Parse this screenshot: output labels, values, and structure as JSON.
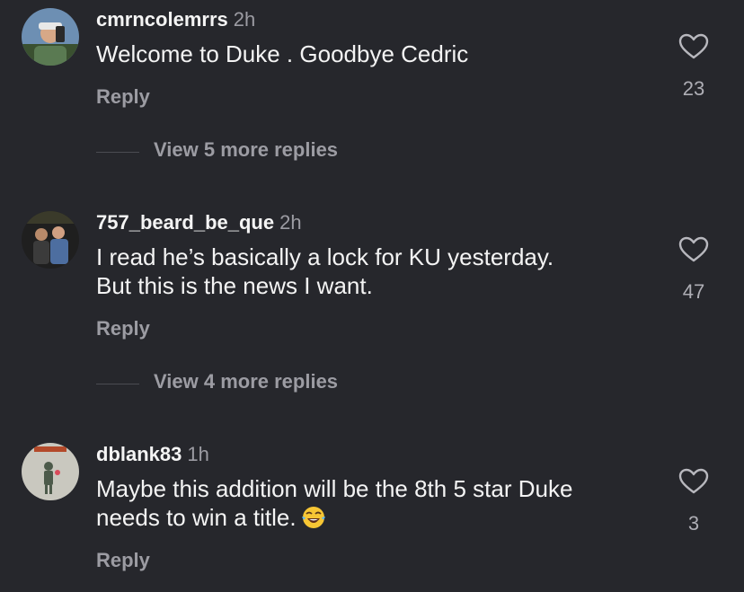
{
  "comments": [
    {
      "username": "cmrncolemrrs",
      "time": "2h",
      "text": "Welcome to Duke . Goodbye Cedric",
      "reply_label": "Reply",
      "likes": "23",
      "view_more": "View 5 more replies",
      "avatar_icon": "profile-photo-man-selfie"
    },
    {
      "username": "757_beard_be_que",
      "time": "2h",
      "text_line1": "I read he’s basically a lock for KU yesterday.",
      "text_line2": "But this is the news I want.",
      "reply_label": "Reply",
      "likes": "47",
      "view_more": "View 4 more replies",
      "avatar_icon": "profile-photo-two-men"
    },
    {
      "username": "dblank83",
      "time": "1h",
      "text_line1": "Maybe this addition will be the 8th 5 star Duke",
      "text_line2": "needs to win a title.",
      "emoji": "tears-of-joy-emoji",
      "reply_label": "Reply",
      "likes": "3",
      "avatar_icon": "profile-photo-banksy-art"
    }
  ],
  "colors": {
    "background": "#26272c",
    "primary_text": "#f4f4f4",
    "secondary_text": "#9c9ca3"
  }
}
